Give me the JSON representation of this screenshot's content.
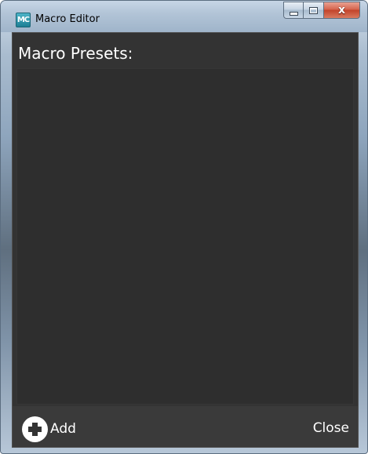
{
  "window": {
    "title": "Macro Editor",
    "icon_text": "MC",
    "icon": "macro-editor-app-icon"
  },
  "caption_buttons": {
    "minimize_icon": "minimize-icon",
    "maximize_icon": "maximize-icon",
    "close_glyph": "x",
    "close_icon": "close-icon"
  },
  "editor": {
    "header": "Macro Presets:",
    "presets": []
  },
  "footer": {
    "add_label": "Add",
    "add_icon": "plus-circle-icon",
    "close_label": "Close"
  },
  "colors": {
    "client_background": "#333333",
    "list_background": "#2e2e2e",
    "text": "#ffffff"
  }
}
